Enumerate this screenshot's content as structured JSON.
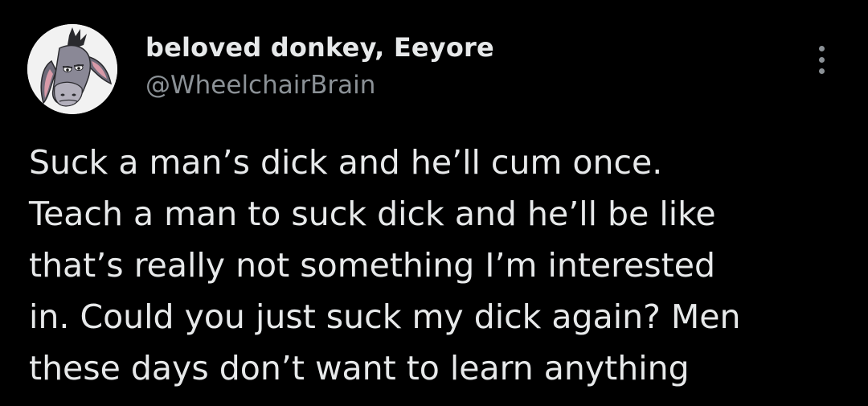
{
  "author": {
    "display_name": "beloved donkey, Eeyore",
    "handle": "@WheelchairBrain",
    "avatar_icon": "eeyore-avatar-icon"
  },
  "menu": {
    "icon": "more-options-icon"
  },
  "tweet": {
    "lines": [
      "Suck a man’s dick and he’ll cum once.",
      "Teach a man to suck dick and he’ll be like",
      "that’s really not something I’m interested",
      "in. Could you just suck my dick again? Men",
      "these days don’t want to learn anything"
    ]
  },
  "colors": {
    "background": "#000000",
    "primary_text": "#e7e9ea",
    "secondary_text": "#8b9196"
  }
}
